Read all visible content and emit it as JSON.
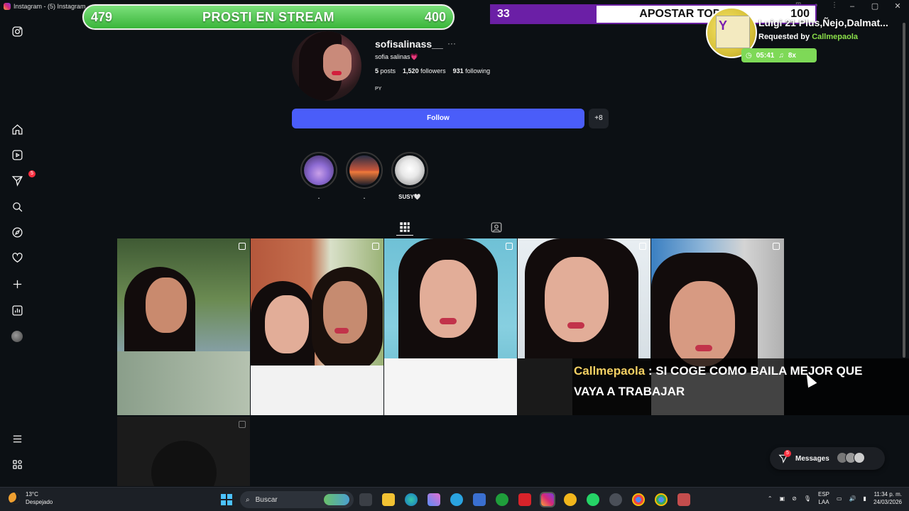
{
  "window": {
    "title": "Instagram - (5) Instagram",
    "controls": [
      "–",
      "▢",
      "✕"
    ]
  },
  "overlays": {
    "stream_bar": {
      "left_count": "479",
      "label": "PROSTI EN STREAM",
      "right_count": "400"
    },
    "bet_bar": {
      "left_value": "33",
      "label": "APOSTAR TODO",
      "right_value": "100"
    },
    "now_playing": {
      "title": "Luigi 21 Plus,Ñejo,Dalmat...",
      "requested_prefix": "Requested by ",
      "requested_by": "Callmepaola",
      "time": "05:41",
      "count": "8x"
    },
    "chat": {
      "user": "Callmepaola",
      "separator": " : ",
      "line1": "SI COGE COMO BAILA MEJOR QUE",
      "line2": "VAYA A TRABAJAR"
    }
  },
  "sidebar": {
    "notifications_badge": "5",
    "items": [
      {
        "name": "instagram",
        "icon": "instagram-icon"
      },
      {
        "name": "home",
        "icon": "home-icon"
      },
      {
        "name": "reels",
        "icon": "reels-icon"
      },
      {
        "name": "messages",
        "icon": "send-icon"
      },
      {
        "name": "search",
        "icon": "search-icon"
      },
      {
        "name": "explore",
        "icon": "compass-icon"
      },
      {
        "name": "notifications",
        "icon": "heart-icon"
      },
      {
        "name": "create",
        "icon": "plus-icon"
      },
      {
        "name": "dashboard",
        "icon": "chart-icon"
      },
      {
        "name": "profile",
        "icon": "avatar"
      },
      {
        "name": "more",
        "icon": "menu-icon"
      },
      {
        "name": "also-from-meta",
        "icon": "apps-icon"
      }
    ]
  },
  "profile": {
    "username": "sofisalinass__",
    "more": "···",
    "full_name": "sofia salinas",
    "full_name_heart": "💗",
    "posts_count": "5",
    "posts_label": "posts",
    "followers_count": "1,520",
    "followers_label": "followers",
    "following_count": "931",
    "following_label": "following",
    "bio": "PY",
    "follow_label": "Follow",
    "suggest_label": "+8"
  },
  "highlights": [
    {
      "label": ".",
      "colors": [
        "#8d6bd3",
        "#3b2a5a"
      ]
    },
    {
      "label": ".",
      "colors": [
        "#f07a3a",
        "#2a2f45"
      ]
    },
    {
      "label": "SUSY🤍",
      "colors": [
        "#f0f0f0",
        "#8a8a8a"
      ]
    }
  ],
  "messages_pill": {
    "label": "Messages",
    "badge": "5"
  },
  "taskbar": {
    "temperature": "13°C",
    "weather": "Despejado",
    "search_placeholder": "Buscar",
    "lang_top": "ESP",
    "lang_bottom": "LAA",
    "time": "11:34 p. m.",
    "date": "24/03/2026"
  },
  "colors": {
    "background": "#0c1014",
    "follow_button": "#4a5df9",
    "stream_green": "#3ab53a",
    "bet_purple": "#6b1fa6",
    "chat_user": "#f3d063",
    "badge_red": "#ff3040"
  }
}
